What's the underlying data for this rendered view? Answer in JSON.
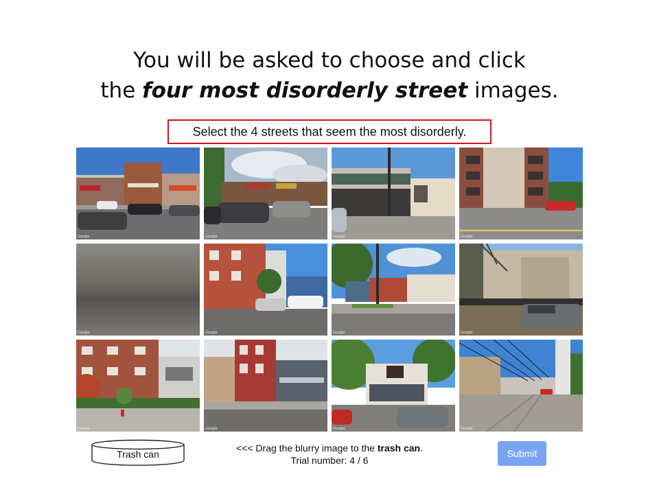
{
  "heading": {
    "line1": "You will be asked to choose and click",
    "line2_pre": "the ",
    "line2_emph": "four most disorderly street",
    "line2_post": " images."
  },
  "instruction": "Select the 4 streets that seem the most disorderly.",
  "tiles": [
    {
      "id": "tile-1",
      "watermark": "Google"
    },
    {
      "id": "tile-2",
      "watermark": "Google"
    },
    {
      "id": "tile-3",
      "watermark": "Google"
    },
    {
      "id": "tile-4",
      "watermark": "Google"
    },
    {
      "id": "tile-5",
      "watermark": "Google"
    },
    {
      "id": "tile-6",
      "watermark": "Google"
    },
    {
      "id": "tile-7",
      "watermark": "Google"
    },
    {
      "id": "tile-8",
      "watermark": "Google"
    },
    {
      "id": "tile-9",
      "watermark": "Google"
    },
    {
      "id": "tile-10",
      "watermark": "Google"
    },
    {
      "id": "tile-11",
      "watermark": "Google"
    },
    {
      "id": "tile-12",
      "watermark": "Google"
    }
  ],
  "trash": {
    "label": "Trash can"
  },
  "footer": {
    "drag_pre": "<<< Drag the blurry image to the ",
    "drag_bold": "trash can",
    "drag_post": ".",
    "trial": "Trial number: 4 / 6"
  },
  "submit_label": "Submit",
  "colors": {
    "highlight_border": "#d0161e",
    "submit_bg": "#7aa4f3"
  }
}
